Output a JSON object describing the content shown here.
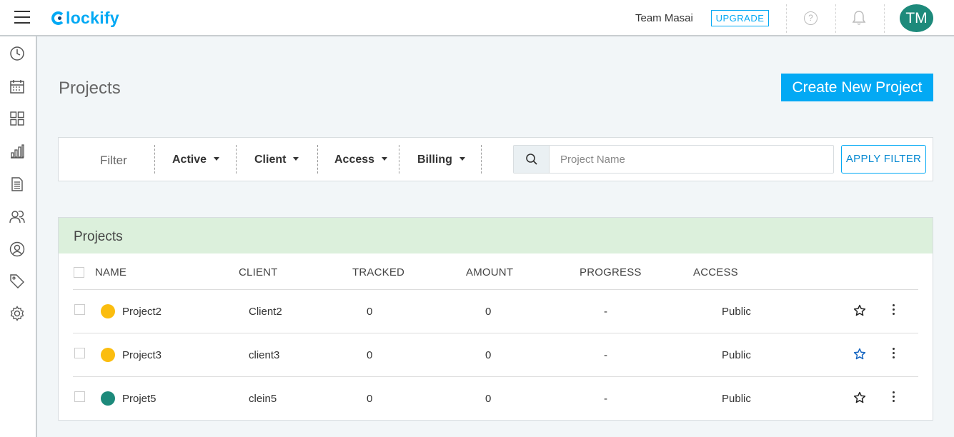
{
  "header": {
    "logo": "lockify",
    "team_name": "Team Masai",
    "upgrade_label": "UPGRADE",
    "avatar_initials": "TM",
    "avatar_color": "#1d8a7b"
  },
  "sidebar": {
    "items": [
      {
        "icon": "clock-icon"
      },
      {
        "icon": "calendar-icon"
      },
      {
        "icon": "dashboard-icon"
      },
      {
        "icon": "reports-icon"
      },
      {
        "icon": "projects-icon"
      },
      {
        "icon": "team-icon"
      },
      {
        "icon": "clients-icon"
      },
      {
        "icon": "tags-icon"
      },
      {
        "icon": "settings-icon"
      }
    ]
  },
  "page": {
    "title": "Projects",
    "create_button": "Create New Project"
  },
  "filter": {
    "label": "Filter",
    "dropdowns": [
      "Active",
      "Client",
      "Access",
      "Billing"
    ],
    "search_placeholder": "Project Name",
    "apply_label": "APPLY FILTER"
  },
  "table": {
    "title": "Projects",
    "columns": [
      "NAME",
      "CLIENT",
      "TRACKED",
      "AMOUNT",
      "PROGRESS",
      "ACCESS"
    ],
    "rows": [
      {
        "name": "Project2",
        "color": "#fbbd0f",
        "client": "Client2",
        "tracked": "0",
        "amount": "0",
        "progress": "-",
        "access": "Public",
        "favorite": false
      },
      {
        "name": "Project3",
        "color": "#fbbd0f",
        "client": "client3",
        "tracked": "0",
        "amount": "0",
        "progress": "-",
        "access": "Public",
        "favorite": true
      },
      {
        "name": "Projet5",
        "color": "#1d8a7b",
        "client": "clein5",
        "tracked": "0",
        "amount": "0",
        "progress": "-",
        "access": "Public",
        "favorite": false
      }
    ]
  },
  "colors": {
    "accent": "#03a9f4",
    "table_band": "#dcf0dc"
  }
}
